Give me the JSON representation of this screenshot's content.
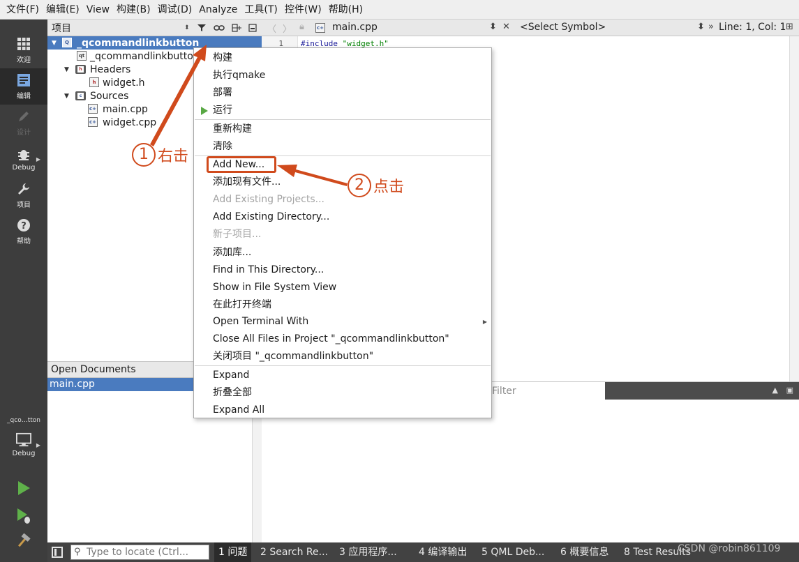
{
  "menubar": {
    "items": [
      "文件(F)",
      "编辑(E)",
      "View",
      "构建(B)",
      "调试(D)",
      "Analyze",
      "工具(T)",
      "控件(W)",
      "帮助(H)"
    ]
  },
  "modes": [
    {
      "label": "欢迎",
      "icon": "grid-icon"
    },
    {
      "label": "编辑",
      "icon": "edit-icon"
    },
    {
      "label": "设计",
      "icon": "pencil-icon"
    },
    {
      "label": "Debug",
      "icon": "bug-icon"
    },
    {
      "label": "项目",
      "icon": "wrench-icon"
    },
    {
      "label": "帮助",
      "icon": "help-icon"
    }
  ],
  "target": {
    "project": "_qco…tton",
    "config": "Debug"
  },
  "project_panel": {
    "title": "项目",
    "tree": [
      {
        "label": "_qcommandlinkbutton",
        "level": 0,
        "selected": true
      },
      {
        "label": "_qcommandlinkbutton",
        "level": 1,
        "selected": false
      },
      {
        "label": "Headers",
        "level": 1,
        "selected": false
      },
      {
        "label": "widget.h",
        "level": 2,
        "selected": false
      },
      {
        "label": "Sources",
        "level": 1,
        "selected": false
      },
      {
        "label": "main.cpp",
        "level": 2,
        "selected": false
      },
      {
        "label": "widget.cpp",
        "level": 2,
        "selected": false
      }
    ]
  },
  "open_documents": {
    "title": "Open Documents",
    "items": [
      "main.cpp"
    ]
  },
  "editor": {
    "file": "main.cpp",
    "symbol": "<Select Symbol>",
    "position": "Line: 1, Col: 1",
    "line_number": "1",
    "code_keyword": "#include ",
    "code_string": "\"widget.h\""
  },
  "output": {
    "filter_placeholder": "Filter"
  },
  "context_menu": {
    "items": [
      {
        "label": "构建",
        "disabled": false
      },
      {
        "label": "执行qmake",
        "disabled": false
      },
      {
        "label": "部署",
        "disabled": false
      },
      {
        "label": "运行",
        "disabled": false
      },
      {
        "label": "重新构建",
        "disabled": false
      },
      {
        "label": "清除",
        "disabled": false
      },
      {
        "label": "Add New...",
        "disabled": false
      },
      {
        "label": "添加现有文件...",
        "disabled": false
      },
      {
        "label": "Add Existing Projects...",
        "disabled": true
      },
      {
        "label": "Add Existing Directory...",
        "disabled": false
      },
      {
        "label": "新子项目...",
        "disabled": true
      },
      {
        "label": "添加库...",
        "disabled": false
      },
      {
        "label": "Find in This Directory...",
        "disabled": false
      },
      {
        "label": "Show in File System View",
        "disabled": false
      },
      {
        "label": "在此打开终端",
        "disabled": false
      },
      {
        "label": "Open Terminal With",
        "disabled": false
      },
      {
        "label": "Close All Files in Project \"_qcommandlinkbutton\"",
        "disabled": false
      },
      {
        "label": "关闭项目 \"_qcommandlinkbutton\"",
        "disabled": false
      },
      {
        "label": "Expand",
        "disabled": false
      },
      {
        "label": "折叠全部",
        "disabled": false
      },
      {
        "label": "Expand All",
        "disabled": false
      }
    ]
  },
  "statusbar": {
    "locate_placeholder": "Type to locate (Ctrl...",
    "tabs": [
      "1 问题",
      "2 Search Re...",
      "3 应用程序...",
      "4 编译输出",
      "5 QML Deb...",
      "6 概要信息",
      "8 Test Results"
    ]
  },
  "annotations": {
    "step1_num": "1",
    "step1_text": "右击",
    "step2_num": "2",
    "step2_text": "点击",
    "color": "#d04a1c"
  },
  "watermark": "CSDN @robin861109"
}
